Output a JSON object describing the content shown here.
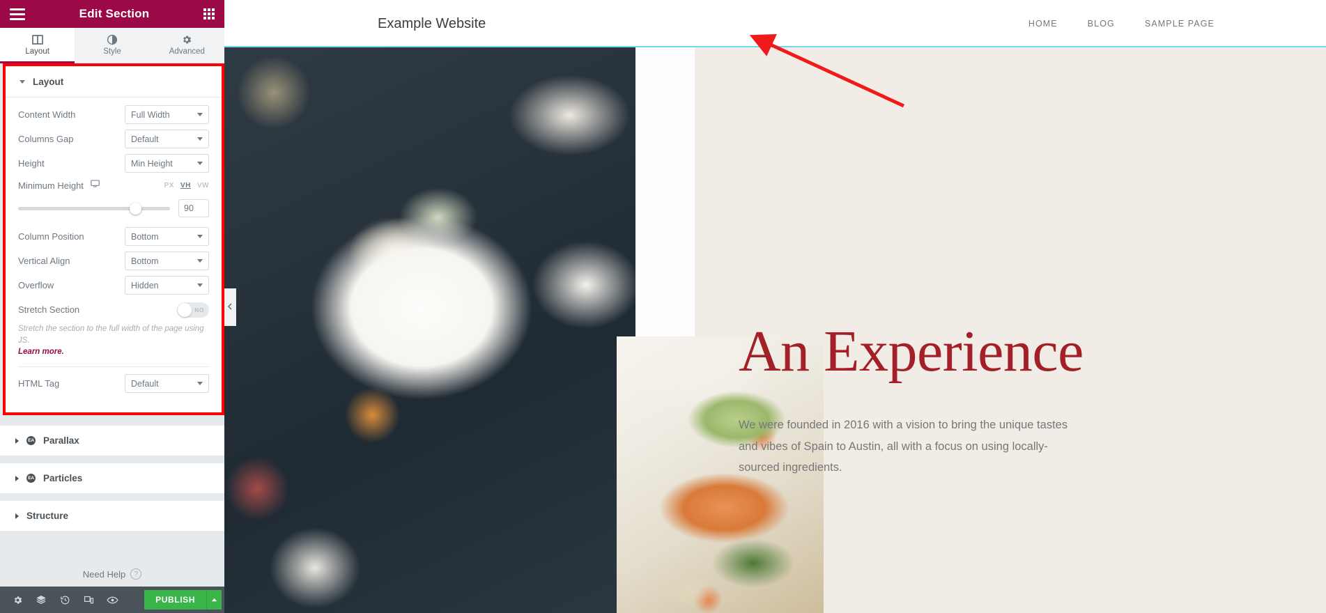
{
  "panel": {
    "header": {
      "title": "Edit Section",
      "menu_icon": "hamburger-icon",
      "apps_icon": "apps-grid-icon"
    },
    "tabs": [
      {
        "label": "Layout",
        "icon": "layout-columns-icon",
        "active": true
      },
      {
        "label": "Style",
        "icon": "contrast-circle-icon",
        "active": false
      },
      {
        "label": "Advanced",
        "icon": "gear-icon",
        "active": false
      }
    ],
    "layout_section": {
      "title": "Layout",
      "controls": [
        {
          "label": "Content Width",
          "value": "Full Width"
        },
        {
          "label": "Columns Gap",
          "value": "Default"
        },
        {
          "label": "Height",
          "value": "Min Height"
        }
      ],
      "minimum_height": {
        "label": "Minimum Height",
        "device_icon": "desktop-icon",
        "units": [
          "PX",
          "VH",
          "VW"
        ],
        "active_unit": "VH",
        "value": "90"
      },
      "controls2": [
        {
          "label": "Column Position",
          "value": "Bottom"
        },
        {
          "label": "Vertical Align",
          "value": "Bottom"
        },
        {
          "label": "Overflow",
          "value": "Hidden"
        }
      ],
      "stretch": {
        "label": "Stretch Section",
        "toggle_value": "NO",
        "description": "Stretch the section to the full width of the page using JS.",
        "link": "Learn more."
      },
      "html_tag": {
        "label": "HTML Tag",
        "value": "Default"
      }
    },
    "accordions": [
      {
        "label": "Parallax",
        "pro": true,
        "badge": "EA"
      },
      {
        "label": "Particles",
        "pro": true,
        "badge": "EA"
      },
      {
        "label": "Structure",
        "pro": false,
        "badge": ""
      }
    ],
    "need_help": "Need Help",
    "footer": {
      "icons": [
        "gear-icon",
        "layers-icon",
        "history-icon",
        "responsive-mode-icon",
        "preview-eye-icon"
      ],
      "publish_label": "PUBLISH"
    },
    "collapse_icon": "chevron-left-icon"
  },
  "canvas": {
    "site_title": "Example Website",
    "nav": [
      "HOME",
      "BLOG",
      "SAMPLE PAGE"
    ],
    "section_toolbar": {
      "add": "+",
      "grid": "columns-grid-icon",
      "close": "×"
    },
    "hero": {
      "headline": "An Experience",
      "paragraph": "We were founded in 2016 with a vision to bring the unique tastes and vibes of Spain to Austin, all with a focus on using locally-sourced ingredients."
    }
  },
  "colors": {
    "panel_header": "#9b0a46",
    "accent_red": "#ff0000",
    "publish_green": "#39b54a",
    "section_outline": "#71d7f7",
    "headline_red": "#a42028",
    "hero_bg": "#f2ece6"
  }
}
